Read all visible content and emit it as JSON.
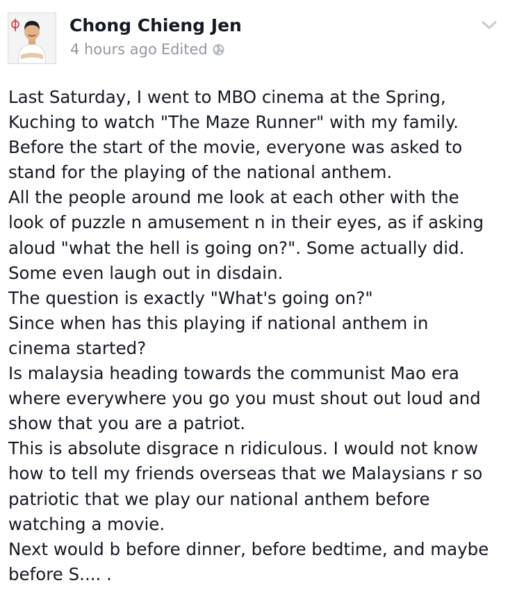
{
  "post": {
    "author": "Chong Chieng Jen",
    "time": "4 hours ago",
    "edited": "Edited",
    "privacy_icon": "globe-icon",
    "menu_icon": "chevron-down-icon",
    "lines": [
      "Last Saturday, I went to MBO cinema at the Spring,",
      "Kuching to watch \"The Maze Runner\" with my family.",
      "Before the start of the movie, everyone was asked to",
      "stand for the playing of the national anthem.",
      "All the people around me look at each other with the",
      "look of puzzle n amusement n in their eyes, as if asking",
      "aloud \"what the hell is going on?\". Some actually did.",
      "Some even laugh out in disdain.",
      "The question is exactly \"What's going on?\"",
      "Since when has this playing if national anthem in",
      "cinema started?",
      "Is malaysia heading towards the communist Mao era",
      "where everywhere you go you must shout out loud and",
      "show that you are a patriot.",
      "This is absolute disgrace n ridiculous. I would not know",
      "how to tell my friends overseas that we Malaysians r so",
      "patriotic that we play our national anthem before",
      "watching a movie.",
      "Next would b before dinner, before bedtime, and maybe",
      "before S.... ."
    ]
  },
  "colors": {
    "name": "#141823",
    "meta": "#9197a3",
    "body_text": "#141823",
    "chevron": "#c4c8cf"
  }
}
